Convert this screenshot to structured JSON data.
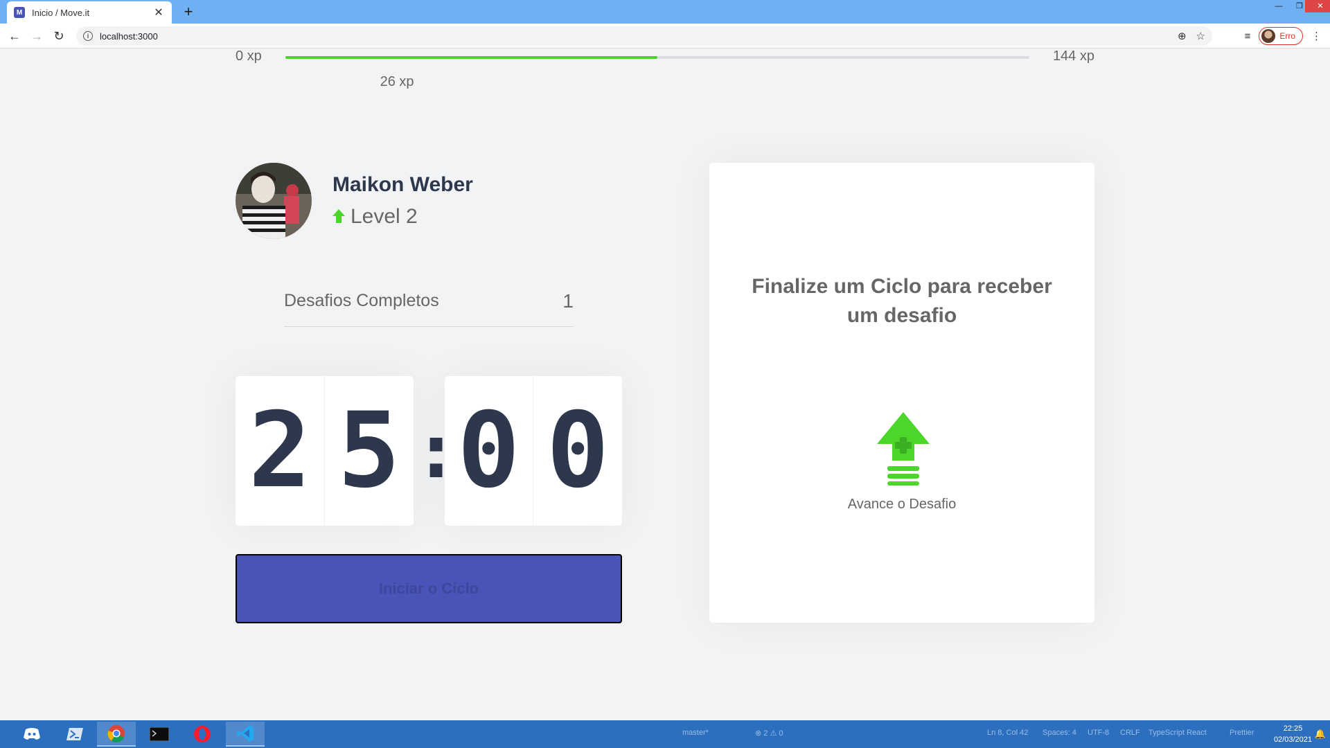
{
  "browser": {
    "tab_title": "Inicio / Move.it",
    "tab_favicon": "M",
    "url": "localhost:3000",
    "profile_label": "Erro"
  },
  "xp": {
    "min_label": "0 xp",
    "max_label": "144 xp",
    "current_label": "26 xp",
    "progress_percent": 50,
    "color": "#4cd62b"
  },
  "profile": {
    "name": "Maikon Weber",
    "level_label": "Level 2"
  },
  "challenges": {
    "label": "Desafios Completos",
    "value": "1"
  },
  "countdown": {
    "minute_left": "2",
    "minute_right": "5",
    "separator": ":",
    "second_left": "0",
    "second_right": "0"
  },
  "start_button_label": "Iniciar o Ciclo",
  "challenge_box": {
    "title": "Finalize um Ciclo para receber um desafio",
    "hint": "Avance o Desafio"
  },
  "taskbar": {
    "git_branch": "master*",
    "problems": "⊗ 2 ⚠ 0",
    "cursor_pos": "Ln 8, Col 42",
    "spaces": "Spaces: 4",
    "encoding": "UTF-8",
    "line_ending": "CRLF",
    "language": "TypeScript React",
    "formatter": "Prettier",
    "time": "22:25",
    "date": "02/03/2021"
  },
  "colors": {
    "accent": "#4953b8",
    "green": "#4cd62b",
    "title": "#2e384d",
    "text": "#666666",
    "background": "#f2f3f5"
  }
}
